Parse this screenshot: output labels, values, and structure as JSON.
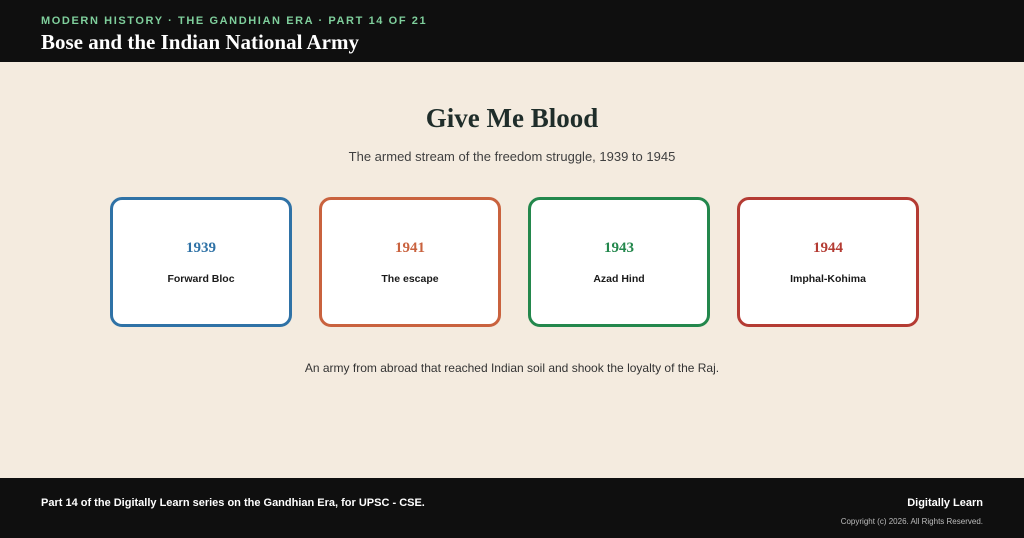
{
  "header": {
    "eyebrow": "MODERN HISTORY · THE GANDHIAN ERA · PART 14 OF 21",
    "title": "Bose and the Indian National Army"
  },
  "main": {
    "heading": "Give Me Blood",
    "subtitle": "The armed stream of the freedom struggle, 1939 to 1945",
    "cards": [
      {
        "year": "1939",
        "label": "Forward Bloc",
        "color": "#2f72a6"
      },
      {
        "year": "1941",
        "label": "The escape",
        "color": "#c9623e"
      },
      {
        "year": "1943",
        "label": "Azad Hind",
        "color": "#23874c"
      },
      {
        "year": "1944",
        "label": "Imphal-Kohima",
        "color": "#b43b33"
      }
    ],
    "caption": "An army from abroad that reached Indian soil and shook the loyalty of the Raj."
  },
  "footer": {
    "text": "Part 14 of the Digitally Learn series on the Gandhian Era, for UPSC - CSE.",
    "brand": "Digitally Learn",
    "copyright": "Copyright (c) 2026. All Rights Reserved."
  }
}
